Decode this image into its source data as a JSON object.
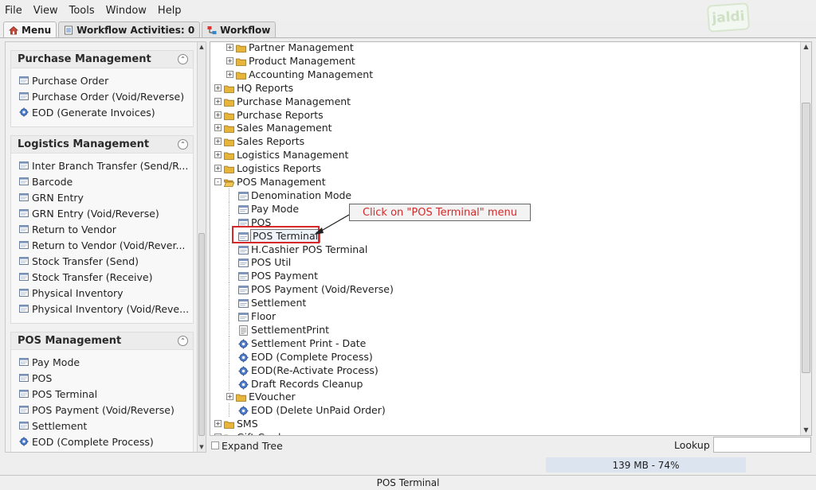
{
  "menubar": {
    "items": [
      "File",
      "View",
      "Tools",
      "Window",
      "Help"
    ],
    "logo": "jaldi"
  },
  "tabs": [
    {
      "label": "Menu",
      "icon": "home-icon"
    },
    {
      "label": "Workflow Activities: 0",
      "icon": "document-icon"
    },
    {
      "label": "Workflow",
      "icon": "workflow-icon"
    }
  ],
  "sidebar": {
    "sections": [
      {
        "title": "Purchase Management",
        "items": [
          {
            "label": "Purchase Order",
            "icon": "window-icon"
          },
          {
            "label": "Purchase Order (Void/Reverse)",
            "icon": "window-icon"
          },
          {
            "label": "EOD (Generate Invoices)",
            "icon": "process-icon"
          }
        ]
      },
      {
        "title": "Logistics Management",
        "items": [
          {
            "label": "Inter Branch Transfer (Send/R...",
            "icon": "window-icon"
          },
          {
            "label": "Barcode",
            "icon": "window-icon"
          },
          {
            "label": "GRN Entry",
            "icon": "window-icon"
          },
          {
            "label": "GRN Entry (Void/Reverse)",
            "icon": "window-icon"
          },
          {
            "label": "Return to Vendor",
            "icon": "window-icon"
          },
          {
            "label": "Return to Vendor (Void/Rever...",
            "icon": "window-icon"
          },
          {
            "label": "Stock Transfer (Send)",
            "icon": "window-icon"
          },
          {
            "label": "Stock Transfer (Receive)",
            "icon": "window-icon"
          },
          {
            "label": "Physical Inventory",
            "icon": "window-icon"
          },
          {
            "label": "Physical Inventory (Void/Reve...",
            "icon": "window-icon"
          }
        ]
      },
      {
        "title": "POS Management",
        "items": [
          {
            "label": "Pay Mode",
            "icon": "window-icon"
          },
          {
            "label": "POS",
            "icon": "window-icon"
          },
          {
            "label": "POS Terminal",
            "icon": "window-icon"
          },
          {
            "label": "POS Payment (Void/Reverse)",
            "icon": "window-icon"
          },
          {
            "label": "Settlement",
            "icon": "window-icon"
          },
          {
            "label": "EOD (Complete Process)",
            "icon": "process-icon"
          }
        ]
      }
    ]
  },
  "tree": {
    "rows": [
      {
        "label": "Partner Management",
        "level": 1,
        "type": "folder",
        "expander": "+"
      },
      {
        "label": "Product Management",
        "level": 1,
        "type": "folder",
        "expander": "+"
      },
      {
        "label": "Accounting Management",
        "level": 1,
        "type": "folder",
        "expander": "+"
      },
      {
        "label": "HQ Reports",
        "level": 0,
        "type": "folder",
        "expander": "+"
      },
      {
        "label": "Purchase Management",
        "level": 0,
        "type": "folder",
        "expander": "+"
      },
      {
        "label": "Purchase Reports",
        "level": 0,
        "type": "folder",
        "expander": "+"
      },
      {
        "label": "Sales Management",
        "level": 0,
        "type": "folder",
        "expander": "+"
      },
      {
        "label": "Sales Reports",
        "level": 0,
        "type": "folder",
        "expander": "+"
      },
      {
        "label": "Logistics Management",
        "level": 0,
        "type": "folder",
        "expander": "+"
      },
      {
        "label": "Logistics Reports",
        "level": 0,
        "type": "folder",
        "expander": "+"
      },
      {
        "label": "POS Management",
        "level": 0,
        "type": "folder-open",
        "expander": "-"
      },
      {
        "label": "Denomination Mode",
        "level": 1,
        "type": "window",
        "expander": ""
      },
      {
        "label": "Pay Mode",
        "level": 1,
        "type": "window",
        "expander": ""
      },
      {
        "label": "POS",
        "level": 1,
        "type": "window",
        "expander": ""
      },
      {
        "label": "POS Terminal",
        "level": 1,
        "type": "window",
        "expander": "",
        "highlighted": true
      },
      {
        "label": "H.Cashier POS Terminal",
        "level": 1,
        "type": "window",
        "expander": ""
      },
      {
        "label": "POS Util",
        "level": 1,
        "type": "window",
        "expander": ""
      },
      {
        "label": "POS Payment",
        "level": 1,
        "type": "window",
        "expander": ""
      },
      {
        "label": "POS Payment (Void/Reverse)",
        "level": 1,
        "type": "window",
        "expander": ""
      },
      {
        "label": "Settlement",
        "level": 1,
        "type": "window",
        "expander": ""
      },
      {
        "label": "Floor",
        "level": 1,
        "type": "window",
        "expander": ""
      },
      {
        "label": "SettlementPrint",
        "level": 1,
        "type": "report",
        "expander": ""
      },
      {
        "label": "Settlement Print - Date",
        "level": 1,
        "type": "process",
        "expander": ""
      },
      {
        "label": "EOD (Complete Process)",
        "level": 1,
        "type": "process",
        "expander": ""
      },
      {
        "label": "EOD(Re-Activate Process)",
        "level": 1,
        "type": "process",
        "expander": ""
      },
      {
        "label": "Draft Records Cleanup",
        "level": 1,
        "type": "process",
        "expander": ""
      },
      {
        "label": "EVoucher",
        "level": 1,
        "type": "folder",
        "expander": "+"
      },
      {
        "label": "EOD (Delete UnPaid Order)",
        "level": 1,
        "type": "process",
        "expander": ""
      },
      {
        "label": "SMS",
        "level": 0,
        "type": "folder",
        "expander": "+"
      },
      {
        "label": "Gift Card",
        "level": 0,
        "type": "folder",
        "expander": "+"
      }
    ]
  },
  "callout": {
    "text": "Click on \"POS Terminal\" menu"
  },
  "bottom": {
    "expand_tree": "Expand Tree",
    "lookup": "Lookup",
    "lookup_value": ""
  },
  "memory": "139 MB - 74%",
  "status": "POS Terminal",
  "colors": {
    "callout_text": "#d32a2a",
    "highlight_box": "#d62828",
    "folder": "#e6b53a"
  }
}
